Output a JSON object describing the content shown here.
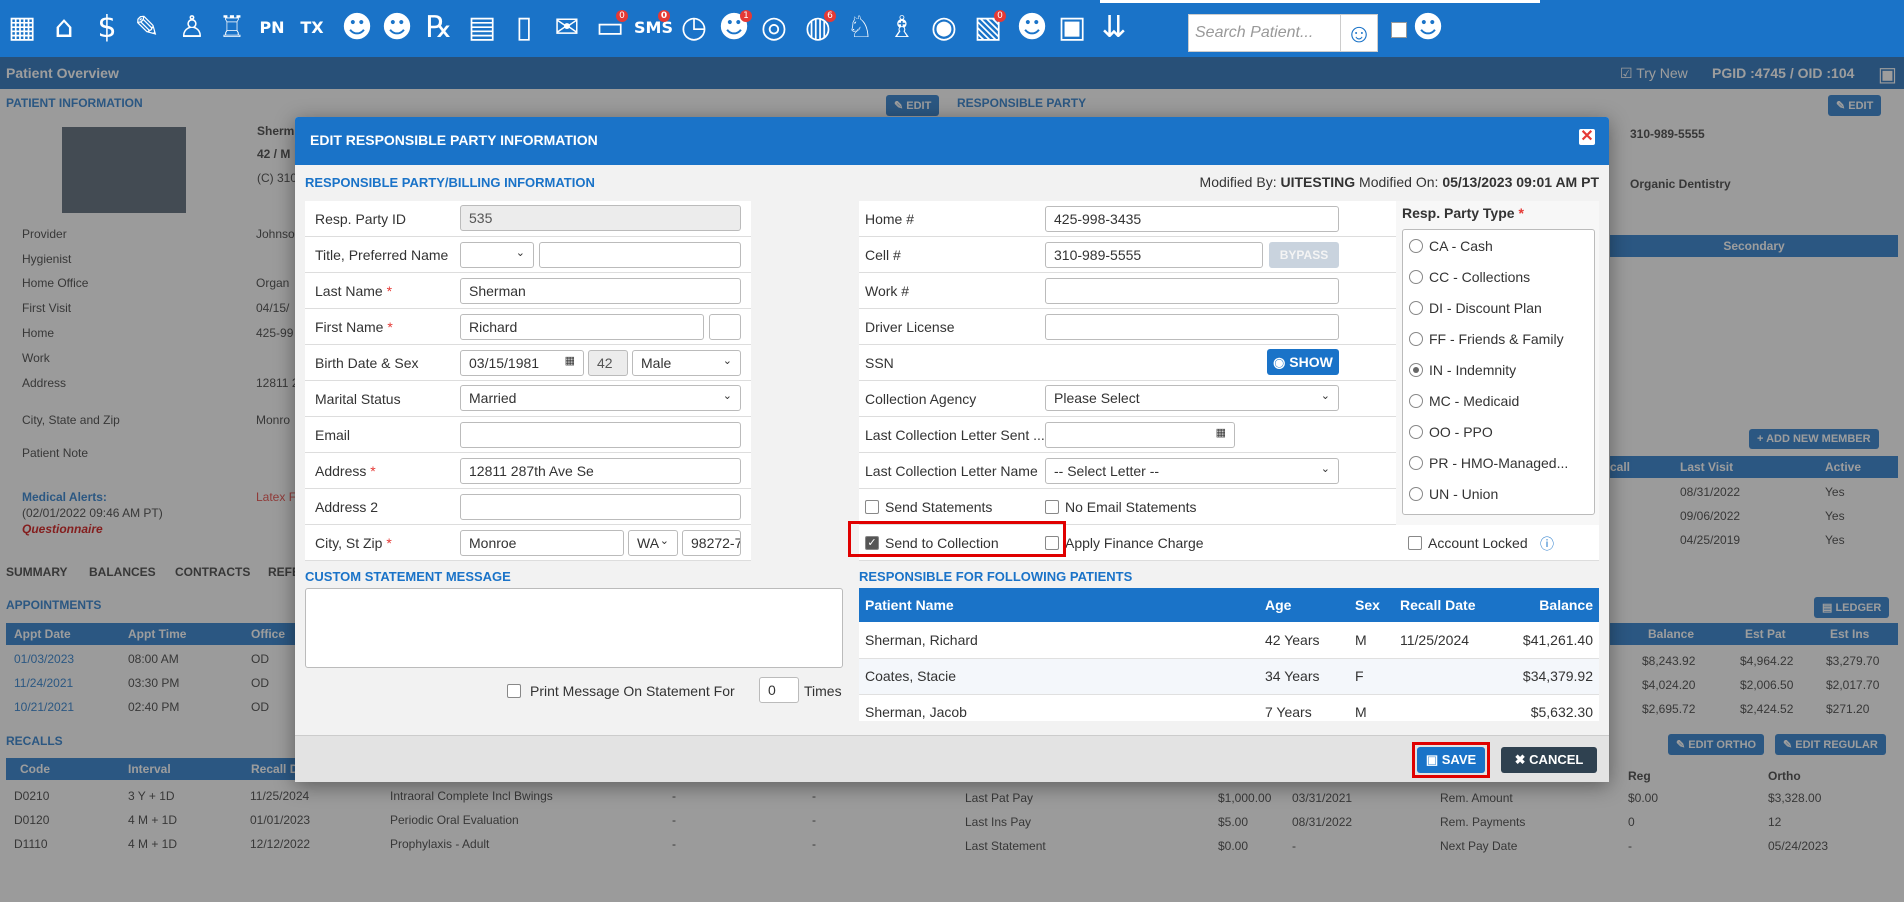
{
  "topbar": {
    "icons": [
      {
        "name": "calendar-icon",
        "glyph": "▦"
      },
      {
        "name": "home-icon",
        "glyph": "⌂"
      },
      {
        "name": "billing-icon",
        "glyph": "$"
      },
      {
        "name": "notes-icon",
        "glyph": "✎"
      },
      {
        "name": "tooth-chart-icon",
        "glyph": "♙"
      },
      {
        "name": "tooth-icon",
        "glyph": "♖"
      },
      {
        "name": "pn-icon",
        "glyph": "PN"
      },
      {
        "name": "tx-icon",
        "glyph": "TX"
      },
      {
        "name": "add-patient-icon",
        "glyph": "☻"
      },
      {
        "name": "add-family-icon",
        "glyph": "☻"
      },
      {
        "name": "rx-icon",
        "glyph": "℞"
      },
      {
        "name": "forms-icon",
        "glyph": "▤"
      },
      {
        "name": "document-icon",
        "glyph": "▯"
      },
      {
        "name": "mail-icon",
        "glyph": "✉"
      },
      {
        "name": "chat-icon",
        "glyph": "▭",
        "badge": "0"
      },
      {
        "name": "sms-icon",
        "glyph": "SMS",
        "badge": "0"
      },
      {
        "name": "clock-icon",
        "glyph": "◷"
      },
      {
        "name": "alerts-icon",
        "glyph": "☻",
        "badge": "1"
      },
      {
        "name": "globe-user-icon",
        "glyph": "◎"
      },
      {
        "name": "support-icon",
        "glyph": "◍",
        "badge": "6"
      },
      {
        "name": "tooth-alt-icon",
        "glyph": "♘"
      },
      {
        "name": "tooth-question-icon",
        "glyph": "♗"
      },
      {
        "name": "web-icon",
        "glyph": "◉"
      },
      {
        "name": "claims-icon",
        "glyph": "▧",
        "badge": "0"
      },
      {
        "name": "group-icon",
        "glyph": "☻"
      },
      {
        "name": "print-icon",
        "glyph": "▣"
      },
      {
        "name": "collapse-icon",
        "glyph": "⇊"
      }
    ],
    "search_placeholder": "Search Patient..."
  },
  "subbar": {
    "title": "Patient Overview",
    "try_new": "Try New",
    "pgid": "PGID :4745  /  OID :104"
  },
  "background": {
    "patient_info": "PATIENT INFORMATION",
    "responsible_party": "RESPONSIBLE PARTY",
    "edit": "EDIT",
    "name_frag": "Sherm",
    "age_frag": "42 / M",
    "phone_frag": "(C) 310",
    "rp_phone": "310-989-5555",
    "rp_office": "Organic Dentistry",
    "secondary": "Secondary",
    "add_new_member": "ADD NEW MEMBER",
    "left_rows": [
      {
        "label": "Provider",
        "value": "Johnso"
      },
      {
        "label": "Hygienist",
        "value": ""
      },
      {
        "label": "Home Office",
        "value": "Organ"
      },
      {
        "label": "First Visit",
        "value": "04/15/"
      },
      {
        "label": "Home",
        "value": "425-99"
      },
      {
        "label": "Work",
        "value": ""
      },
      {
        "label": "Address",
        "value": "12811 2"
      },
      {
        "label": "City, State and Zip",
        "value": "Monro"
      },
      {
        "label": "Patient Note",
        "value": ""
      }
    ],
    "medical_alerts": "Medical Alerts:",
    "alerts_date": "(02/01/2022 09:46 AM PT)",
    "questionnaire": "Questionnaire",
    "latex": "Latex F",
    "tabs": [
      "SUMMARY",
      "BALANCES",
      "CONTRACTS",
      "REFE"
    ],
    "appointments": "APPOINTMENTS",
    "appt_headers": [
      "Appt Date",
      "Appt Time",
      "Office"
    ],
    "appts": [
      [
        "01/03/2023",
        "08:00 AM",
        "OD"
      ],
      [
        "11/24/2021",
        "03:30 PM",
        "OD"
      ],
      [
        "10/21/2021",
        "02:40 PM",
        "OD"
      ]
    ],
    "recalls": "RECALLS",
    "recall_headers": [
      "Code",
      "Interval",
      "Recall D"
    ],
    "recall_rows": [
      [
        "D0210",
        "3 Y + 1D",
        "11/25/2024",
        "Intraoral Complete Incl Bwings",
        "-",
        "-"
      ],
      [
        "D0120",
        "4 M + 1D",
        "01/01/2023",
        "Periodic Oral Evaluation",
        "-",
        "-"
      ],
      [
        "D1110",
        "4 M + 1D",
        "12/12/2022",
        "Prophylaxis - Adult",
        "-",
        "-"
      ]
    ],
    "members_headers": [
      "call",
      "Last Visit",
      "Active"
    ],
    "members": [
      [
        "",
        "08/31/2022",
        "Yes"
      ],
      [
        "",
        "09/06/2022",
        "Yes"
      ],
      [
        "",
        "04/25/2019",
        "Yes"
      ]
    ],
    "ledger": "LEDGER",
    "bal_headers": [
      "Balance",
      "Est Pat",
      "Est Ins"
    ],
    "bal_rows": [
      [
        "$8,243.92",
        "$4,964.22",
        "$3,279.70"
      ],
      [
        "$4,024.20",
        "$2,006.50",
        "$2,017.70"
      ],
      [
        "$2,695.72",
        "$2,424.52",
        "$271.20"
      ]
    ],
    "edit_ortho": "EDIT ORTHO",
    "edit_regular": "EDIT REGULAR",
    "pay_rows": [
      [
        "Last Pat Pay",
        "$1,000.00",
        "03/31/2021"
      ],
      [
        "Last Ins Pay",
        "$5.00",
        "08/31/2022"
      ],
      [
        "Last Statement",
        "$0.00",
        "-"
      ]
    ],
    "ortho_headers": [
      "Reg",
      "Ortho"
    ],
    "ortho_rows": [
      [
        "Rem. Amount",
        "$0.00",
        "$3,328.00"
      ],
      [
        "Rem. Payments",
        "0",
        "12"
      ],
      [
        "Next Pay Date",
        "-",
        "05/24/2023"
      ]
    ]
  },
  "modal": {
    "title": "EDIT RESPONSIBLE PARTY INFORMATION",
    "section_billing": "RESPONSIBLE PARTY/BILLING INFORMATION",
    "modified_by_label": "Modified By:",
    "modified_by": "UITESTING",
    "modified_on_label": "Modified On:",
    "modified_on": "05/13/2023 09:01 AM PT",
    "left": {
      "resp_party_id_label": "Resp. Party ID",
      "resp_party_id": "535",
      "title_label": "Title, Preferred Name",
      "last_name_label": "Last Name",
      "last_name": "Sherman",
      "first_name_label": "First Name",
      "first_name": "Richard",
      "birth_label": "Birth Date & Sex",
      "birth_date": "03/15/1981",
      "age": "42",
      "sex": "Male",
      "marital_label": "Marital Status",
      "marital": "Married",
      "email_label": "Email",
      "address_label": "Address",
      "address": "12811 287th Ave Se",
      "address2_label": "Address 2",
      "city_label": "City, St Zip",
      "city": "Monroe",
      "state": "WA",
      "zip": "98272-7"
    },
    "mid": {
      "home_label": "Home #",
      "home": "425-998-3435",
      "cell_label": "Cell #",
      "cell": "310-989-5555",
      "bypass": "BYPASS",
      "work_label": "Work #",
      "dl_label": "Driver License",
      "ssn_label": "SSN",
      "show": "SHOW",
      "collection_agency_label": "Collection Agency",
      "collection_agency": "Please Select",
      "last_letter_sent_label": "Last Collection Letter Sent ...",
      "last_letter_name_label": "Last Collection Letter Name",
      "last_letter_name": "-- Select Letter --",
      "send_statements": "Send Statements",
      "no_email_statements": "No Email Statements",
      "send_to_collection": "Send to Collection",
      "apply_finance_charge": "Apply Finance Charge"
    },
    "types": {
      "label": "Resp. Party Type",
      "options": [
        "CA - Cash",
        "CC - Collections",
        "DI - Discount Plan",
        "FF - Friends & Family",
        "IN - Indemnity",
        "MC - Medicaid",
        "OO - PPO",
        "PR - HMO-Managed...",
        "UN - Union"
      ],
      "selected": "IN - Indemnity",
      "account_locked": "Account Locked"
    },
    "custom_message": "CUSTOM STATEMENT MESSAGE",
    "print_message": "Print Message On Statement For",
    "print_times": "0",
    "times": "Times",
    "patients_section": "RESPONSIBLE FOR FOLLOWING PATIENTS",
    "patient_headers": [
      "Patient Name",
      "Age",
      "Sex",
      "Recall Date",
      "Balance"
    ],
    "patients": [
      [
        "Sherman, Richard",
        "42 Years",
        "M",
        "11/25/2024",
        "$41,261.40"
      ],
      [
        "Coates, Stacie",
        "34 Years",
        "F",
        "",
        "$34,379.92"
      ],
      [
        "Sherman, Jacob",
        "7 Years",
        "M",
        "",
        "$5,632.30"
      ]
    ],
    "save": "SAVE",
    "cancel": "CANCEL"
  }
}
